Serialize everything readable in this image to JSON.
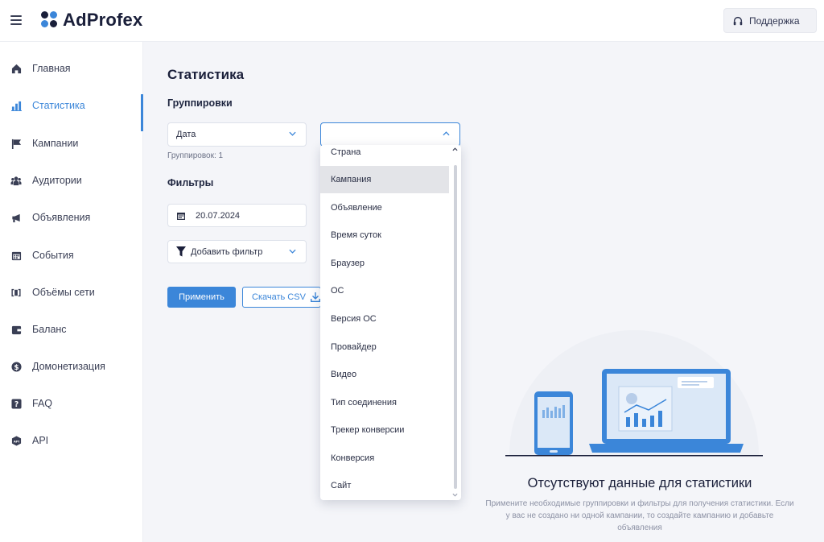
{
  "app": {
    "logo_text": "AdProfex",
    "support_label": "Поддержка"
  },
  "colors": {
    "accent": "#3b86d9",
    "logo_dot_1": "#3b86d9",
    "logo_dot_2": "#1a1f3a"
  },
  "sidebar": {
    "items": [
      {
        "label": "Главная",
        "icon": "home-icon"
      },
      {
        "label": "Статистика",
        "icon": "bar-chart-icon",
        "active": true
      },
      {
        "label": "Кампании",
        "icon": "flag-icon"
      },
      {
        "label": "Аудитории",
        "icon": "users-icon"
      },
      {
        "label": "Объявления",
        "icon": "megaphone-icon"
      },
      {
        "label": "События",
        "icon": "calendar-icon"
      },
      {
        "label": "Объёмы сети",
        "icon": "volume-icon"
      },
      {
        "label": "Баланс",
        "icon": "wallet-icon"
      },
      {
        "label": "Домонетизация",
        "icon": "dollar-icon"
      },
      {
        "label": "FAQ",
        "icon": "question-icon"
      },
      {
        "label": "API",
        "icon": "api-icon"
      }
    ]
  },
  "main": {
    "title": "Статистика",
    "groupings_label": "Группировки",
    "grouping_select_value": "Дата",
    "second_select_value": "",
    "groupings_count": "Группировок: 1",
    "filters_label": "Фильтры",
    "date_value": "20.07.2024",
    "add_filter_label": "Добавить фильтр",
    "apply_label": "Применить",
    "csv_label": "Скачать CSV"
  },
  "dropdown": {
    "options": [
      "Страна",
      "Кампания",
      "Объявление",
      "Время суток",
      "Браузер",
      "ОС",
      "Версия ОС",
      "Провайдер",
      "Видео",
      "Тип соединения",
      "Трекер конверсии",
      "Конверсия",
      "Сайт"
    ],
    "highlighted": "Кампания"
  },
  "empty_state": {
    "title": "Отсутствуют данные для статистики",
    "description": "Примените необходимые группировки и фильтры для получения статистики. Если у вас не создано ни одной кампании, то создайте кампанию и добавьте объявления"
  }
}
